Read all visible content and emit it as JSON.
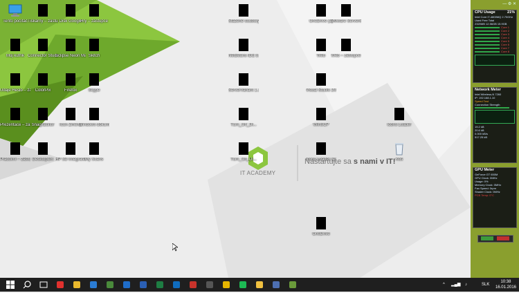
{
  "desktop": {
    "icons": [
      {
        "label": "Tento počítač",
        "kind": "pc"
      },
      {
        "label": "Tiskárny – zástupce",
        "kind": "black"
      },
      {
        "label": "Disk Google",
        "kind": "black"
      },
      {
        "label": "Hry – zástupce",
        "kind": "black"
      },
      {
        "label": "Můj kufřík",
        "kind": "black"
      },
      {
        "label": "Connector Studio 8",
        "kind": "black"
      },
      {
        "label": "Eclipse Neon Mars",
        "kind": "black"
      },
      {
        "label": "Skitch",
        "kind": "black"
      },
      {
        "label": "Údaje Heslo – zástupce",
        "kind": "black"
      },
      {
        "label": "ColorPix",
        "kind": "black"
      },
      {
        "label": "Firefox",
        "kind": "black"
      },
      {
        "label": "Skype",
        "kind": "black"
      },
      {
        "label": "Prezentace – zástupce",
        "kind": "black"
      },
      {
        "label": "SnagitEditor",
        "kind": "black"
      },
      {
        "label": "Icon Zmena",
        "kind": "black"
      },
      {
        "label": "Windows dokumenty",
        "kind": "black"
      },
      {
        "label": "Pracovní – zástupce",
        "kind": "black"
      },
      {
        "label": "DesktopOK",
        "kind": "black"
      },
      {
        "label": "HP 3D Integrated...",
        "kind": "black"
      },
      {
        "label": "My Scans",
        "kind": "black"
      },
      {
        "label": "Stažené soubory",
        "kind": "black"
      },
      {
        "label": "NetBeans IDE 8.1",
        "kind": "black"
      },
      {
        "label": "ServerVariant 1.1",
        "kind": "black"
      },
      {
        "label": "Turn_Off_Di...",
        "kind": "black"
      },
      {
        "label": "Turn_On_Di...",
        "kind": "black"
      },
      {
        "label": "OneDrive (2)",
        "kind": "black"
      },
      {
        "label": "VMware Server64",
        "kind": "black"
      },
      {
        "label": "Web",
        "kind": "black"
      },
      {
        "label": "Web – zástupce",
        "kind": "black"
      },
      {
        "label": "Visual Studio 2013",
        "kind": "black"
      },
      {
        "label": "WinSCP",
        "kind": "black"
      },
      {
        "label": "Icons Loader (2)",
        "kind": "black"
      },
      {
        "label": "Icons Loader",
        "kind": "black"
      },
      {
        "label": "Koš",
        "kind": "recycle"
      },
      {
        "label": "OneDrive",
        "kind": "black"
      }
    ],
    "wallpaper": {
      "brand": "IT ACADEMY",
      "slogan_pre": "Nastartujte sa ",
      "slogan_bold": "s nami v IT!",
      "accent": "#8cc63f",
      "dark_accent": "#5a8f1e"
    },
    "cursor": "arrow-cursor"
  },
  "gadgets": {
    "toolbar_symbols": [
      "—",
      "⚙",
      "✕"
    ],
    "cpu": {
      "title": "CPU Usage",
      "usage": "21%",
      "lines": [
        "Intel Core i7-4800MQ 2.70GHz",
        "Used Free Total",
        "2320MB 12.56GB 15.9GB"
      ],
      "cores": [
        "Core 1",
        "Core 2",
        "Core 3",
        "Core 4",
        "Core 5",
        "Core 6",
        "Core 7",
        "Core 8"
      ]
    },
    "network": {
      "title": "Network Meter",
      "lines": [
        "Intel Wireless-N 7260",
        "IP: 192.168.1.10",
        "Speed Test",
        "Connection Strength"
      ],
      "traffic": [
        "19.2 kB",
        "20.6 kB",
        "0.000 kB/s",
        "517.25 kB"
      ]
    },
    "gpu": {
      "title": "GPU Meter",
      "lines": [
        "GeForce GT 650M",
        "GPU Clock: 0MHz",
        "Usage: 0%",
        "Memory Clock: 0MHz",
        "Fan Speed: 0rpm",
        "Shader Clock: 0MHz",
        "PCB Temp: 0°C"
      ]
    }
  },
  "taskbar": {
    "start_icon": "windows-logo-icon",
    "pinned": [
      "search-icon",
      "task-view-icon",
      "opera-icon",
      "chrome-icon",
      "edge-icon",
      "app-icon",
      "thunderbolt-icon",
      "word-icon",
      "excel-icon",
      "outlook-icon",
      "acrobat-icon",
      "store-icon",
      "notes-icon",
      "spotify-icon",
      "explorer-icon",
      "app2-icon",
      "app3-icon"
    ],
    "tray": {
      "language": "SLK",
      "up_arrow": "^"
    },
    "clock": {
      "time": "10:38",
      "date": "16.01.2016"
    }
  }
}
